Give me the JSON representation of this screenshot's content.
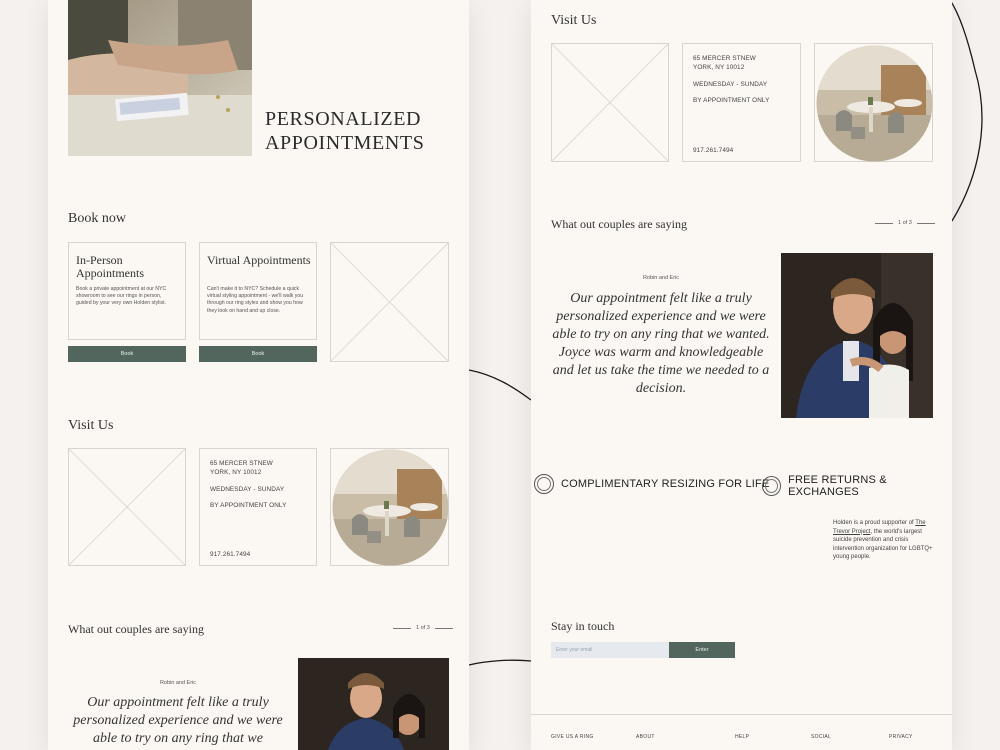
{
  "left": {
    "hero_title": "PERSONALIZED APPOINTMENTS",
    "book_now": "Book now",
    "cards": [
      {
        "title": "In-Person Appointments",
        "text": "Book a private appointment at our NYC showroom to see our rings in person, guided by your very own Holden stylist.",
        "button": "Book"
      },
      {
        "title": "Virtual Appointments",
        "text": "Can't make it to NYC? Schedule a quick virtual styling appointment - we'll walk you through our ring styles and show you how they look on hand and up close.",
        "button": "Book"
      }
    ],
    "visit_us": "Visit Us",
    "address_line1": "65 MERCER STNEW",
    "address_line2": "YORK, NY 10012",
    "days": "WEDNESDAY - SUNDAY",
    "by_appointment": "BY APPOINTMENT ONLY",
    "phone": "917.261.7494",
    "testimonials_title": "What out couples are saying",
    "pager": "1 of 3",
    "reviewer": "Robin and Eric",
    "quote": "Our appointment felt like a truly personalized experience and we were able to try on any ring that we"
  },
  "right": {
    "visit_us": "Visit Us",
    "address_line1": "65 MERCER STNEW",
    "address_line2": "YORK, NY 10012",
    "days": "WEDNESDAY - SUNDAY",
    "by_appointment": "BY APPOINTMENT ONLY",
    "phone": "917.261.7494",
    "testimonials_title": "What out couples are saying",
    "pager": "1 of 3",
    "reviewer": "Robin and Eric",
    "quote": "Our appointment felt like a truly personalized experience and we were able to try on any ring that we wanted. Joyce was warm and knowledgeable and let us take the time we needed to a decision.",
    "feature1": "COMPLIMENTARY RESIZING FOR LIFE",
    "feature2": "FREE RETURNS & EXCHANGES",
    "support_pre": "Holden is a proud supporter of",
    "support_link": "The Trevor Project",
    "support_post": ", the world's largest suicide prevention and crisis intervention organization for LGBTQ+ young people.",
    "stay_title": "Stay in touch",
    "email_placeholder": "Enter your email",
    "enter_button": "Enter",
    "footer": [
      "GIVE US A RING",
      "ABOUT",
      "HELP",
      "SOCIAL",
      "PRIVACY"
    ]
  },
  "colors": {
    "accent": "#53665e",
    "background": "#fbf7f3",
    "input": "#e6eaef"
  }
}
